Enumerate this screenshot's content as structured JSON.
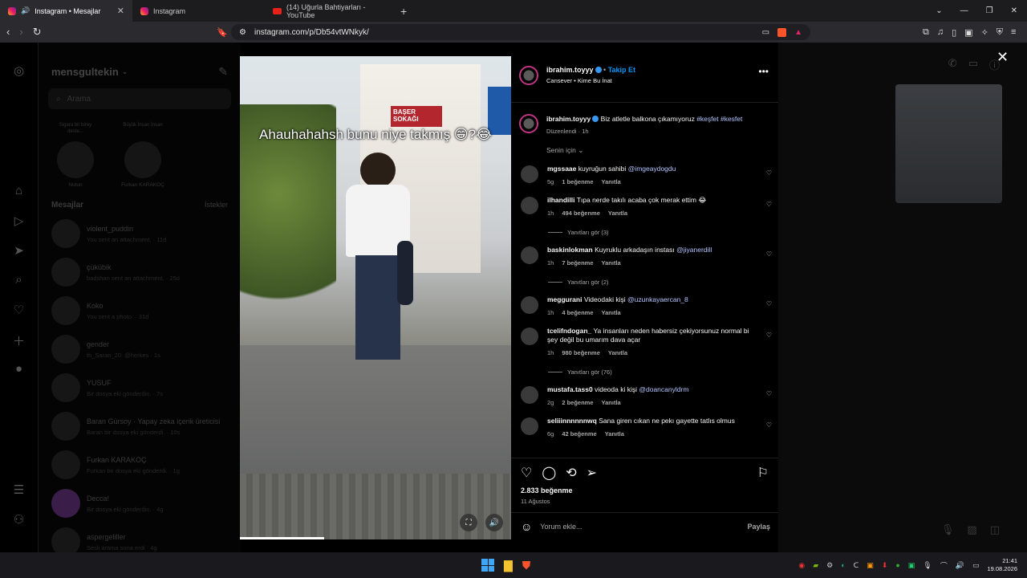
{
  "browser": {
    "tabs": [
      {
        "title": "Instagram • Mesajlar",
        "active": true,
        "favicon": "instagram-icon",
        "audio": true
      },
      {
        "title": "Instagram",
        "active": false,
        "favicon": "instagram-icon"
      },
      {
        "title": "(14) Uğurla Bahtiyarları - YouTube",
        "active": false,
        "favicon": "youtube-icon"
      }
    ],
    "url": "instagram.com/p/Db54vtWNkyk/"
  },
  "dm": {
    "username": "mensgultekin",
    "search_placeholder": "Arama",
    "notes": [
      {
        "bubble": "Sigara bir birey deste...",
        "name": "Notun"
      },
      {
        "bubble": "Büyük İnsan İnsan",
        "name": "Furkan KARAKOÇ"
      }
    ],
    "messages_header": "Mesajlar",
    "requests_label": "İstekler",
    "conversations": [
      {
        "name": "violent_puddin",
        "preview": "You sent an attachment. · 11d"
      },
      {
        "name": "çükübik",
        "preview": "badshan sent an attachment. · 25d"
      },
      {
        "name": "Koko",
        "preview": "You sent a photo. · 31d"
      },
      {
        "name": "gender",
        "preview": "th_Saran_20: @herkes · 1s"
      },
      {
        "name": "YUSUF",
        "preview": "Bir dosya eki gönderdin. · 7s"
      },
      {
        "name": "Baran Gürsoy · Yapay zeka içerik üreticisi",
        "preview": "Baran bir dosya eki gönderdi. · 10s"
      },
      {
        "name": "Furkan KARAKOÇ",
        "preview": "Furkan bir dosya eki gönderdi. · 1g"
      },
      {
        "name": "Decca!",
        "preview": "Bir dosya eki gönderdin. · 4g"
      },
      {
        "name": "aspergeliller",
        "preview": "Sesli arama sona erdi · 4g"
      }
    ]
  },
  "post": {
    "video_caption": "Ahauhahahsh bunu niye takmış 😁?😂",
    "author": "ibrahim.toyyy",
    "follow_label": "Takip Et",
    "audio_line": "Cansever • Kime Bu İnat",
    "caption_text": "Biz atletle balkona çıkamıyoruz",
    "caption_tags": "#keşfet #kesfet",
    "caption_meta": "Düzenlendi · 1h",
    "for_you": "Senin için",
    "comments": [
      {
        "user": "mgssaae",
        "text": "kuyruğun sahibi",
        "mention": "@imgeaydogdu",
        "time": "5g",
        "likes": "1 beğenme",
        "reply": "Yanıtla",
        "replies": ""
      },
      {
        "user": "ilhandilli",
        "text": "Tıpa nerde takılı acaba çok merak ettim 😂",
        "mention": "",
        "time": "1h",
        "likes": "494 beğenme",
        "reply": "Yanıtla",
        "replies": "Yanıtları gör (3)"
      },
      {
        "user": "baskinlokman",
        "text": "Kuyruklu arkadaşın instası",
        "mention": "@jiyanerdill",
        "time": "1h",
        "likes": "7 beğenme",
        "reply": "Yanıtla",
        "replies": "Yanıtları gör (2)"
      },
      {
        "user": "meggurani",
        "text": "Videodaki kişi",
        "mention": "@uzunkayaercan_8",
        "time": "1h",
        "likes": "4 beğenme",
        "reply": "Yanıtla",
        "replies": ""
      },
      {
        "user": "tcelifndogan_",
        "text": "Ya insanları neden habersiz çekiyorsunuz normal bi şey değil bu umarım dava açar",
        "mention": "",
        "time": "1h",
        "likes": "980 beğenme",
        "reply": "Yanıtla",
        "replies": "Yanıtları gör (76)"
      },
      {
        "user": "mustafa.tass0",
        "text": "videoda ki kişi",
        "mention": "@doancanyldrm",
        "time": "2g",
        "likes": "2 beğenme",
        "reply": "Yanıtla",
        "replies": ""
      },
      {
        "user": "seliiinnnnnnwq",
        "text": "Sana giren cıkan ne pekı gayette tatlıs olmus",
        "mention": "",
        "time": "6g",
        "likes": "42 beğenme",
        "reply": "Yanıtla",
        "replies": ""
      }
    ],
    "likes_total": "2.833 beğenme",
    "date": "11 Ağustos",
    "comment_placeholder": "Yorum ekle...",
    "post_button": "Paylaş",
    "street_sign": "BAŞER SOKAĞI",
    "video_progress_fraction": 0.31
  },
  "taskbar": {
    "time": "21:41",
    "date": "19.08.2026"
  },
  "colors": {
    "accent_blue": "#0095f6",
    "tag_blue": "#b4c5ff",
    "brave_orange": "#fb542b"
  }
}
